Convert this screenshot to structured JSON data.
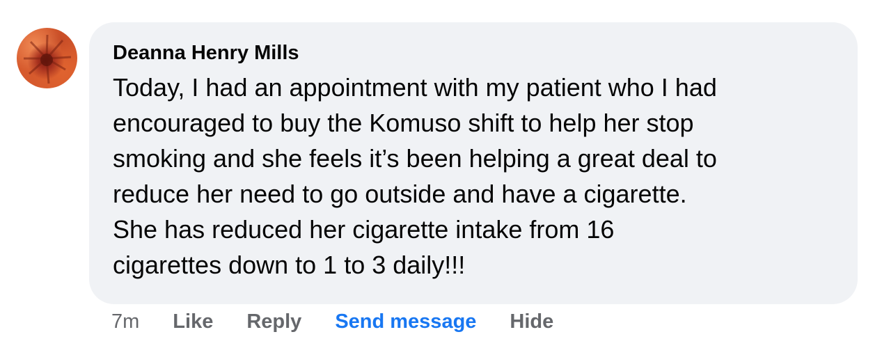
{
  "comment": {
    "author": "Deanna Henry Mills",
    "lines": [
      "Today, I had an appointment with my patient who I had",
      "encouraged to buy the Komuso shift to help her stop",
      "smoking and she feels it’s been helping a great deal to",
      "reduce her need to go outside and have a cigarette.",
      "She has reduced her cigarette intake from 16",
      "cigarettes down to 1 to 3 daily!!!"
    ],
    "timestamp": "7m",
    "actions": {
      "like": "Like",
      "reply": "Reply",
      "send_message": "Send message",
      "hide": "Hide"
    }
  },
  "colors": {
    "bubble_background": "#f0f2f5",
    "text": "#050505",
    "secondary_text": "#65676b",
    "link_blue": "#1877f2"
  }
}
